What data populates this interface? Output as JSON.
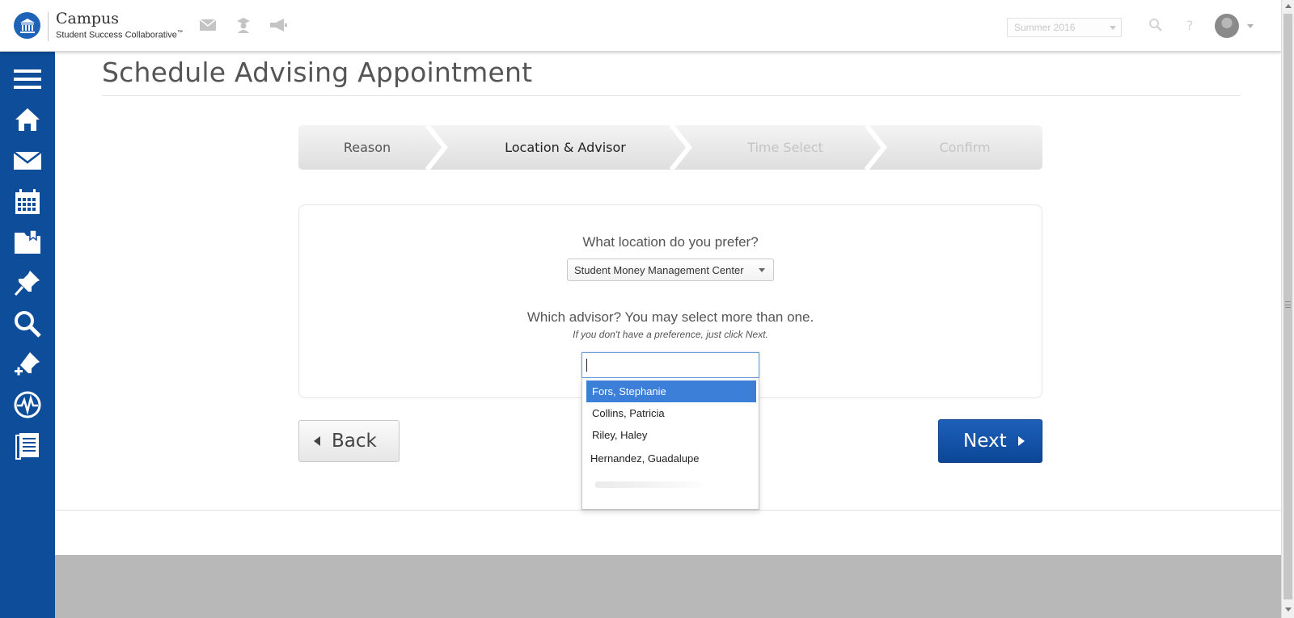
{
  "header": {
    "brand_title": "Campus",
    "brand_subtitle": "Student Success Collaborative",
    "brand_mark": "™",
    "term_selected": "Summer 2016",
    "icons": [
      "logo-icon",
      "mail-icon",
      "student-icon",
      "megaphone-icon",
      "search-icon",
      "help-icon"
    ]
  },
  "sidebar": {
    "items": [
      {
        "name": "menu-icon"
      },
      {
        "name": "home-icon"
      },
      {
        "name": "mail-icon"
      },
      {
        "name": "calendar-icon"
      },
      {
        "name": "folder-icon"
      },
      {
        "name": "pin-icon"
      },
      {
        "name": "search-icon"
      },
      {
        "name": "add-pin-icon"
      },
      {
        "name": "pulse-icon"
      },
      {
        "name": "document-icon"
      }
    ]
  },
  "page": {
    "title": "Schedule Advising Appointment"
  },
  "steps": [
    {
      "label": "Reason",
      "state": "done"
    },
    {
      "label": "Location & Advisor",
      "state": "current"
    },
    {
      "label": "Time Select",
      "state": "pending"
    },
    {
      "label": "Confirm",
      "state": "pending"
    }
  ],
  "form": {
    "location_question": "What location do you prefer?",
    "location_selected": "Student Money Management Center",
    "advisor_question": "Which advisor? You may select more than one.",
    "advisor_hint": "If you don't have a preference, just click Next.",
    "advisor_input_value": "",
    "advisor_options": [
      "Fors, Stephanie",
      "Collins, Patricia",
      "Riley, Haley",
      "Hernandez, Guadalupe"
    ],
    "highlighted_option": 0
  },
  "buttons": {
    "back_label": "Back",
    "next_label": "Next"
  },
  "colors": {
    "sidebar": "#0d4d9a",
    "primary": "#1d5fba",
    "highlight": "#3b7fd9",
    "footer": "#b8b8b8"
  }
}
